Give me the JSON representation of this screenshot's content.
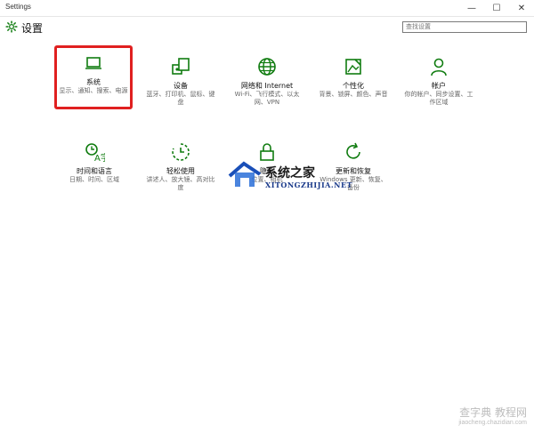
{
  "window": {
    "title": "Settings",
    "min": "—",
    "max": "☐",
    "close": "✕"
  },
  "header": {
    "title": "设置"
  },
  "search": {
    "placeholder": "查找设置"
  },
  "accent_color": "#107c10",
  "selection_color": "#e02020",
  "tiles": [
    {
      "label": "系统",
      "desc": "显示、通知、搜索、电源",
      "icon": "laptop-icon",
      "selected": true
    },
    {
      "label": "设备",
      "desc": "蓝牙、打印机、鼠标、键盘",
      "icon": "devices-icon"
    },
    {
      "label": "网络和 Internet",
      "desc": "Wi-Fi、飞行模式、以太网、VPN",
      "icon": "globe-icon"
    },
    {
      "label": "个性化",
      "desc": "背景、锁屏、颜色、声音",
      "icon": "personalization-icon"
    },
    {
      "label": "帐户",
      "desc": "你的帐户、同步设置、工作区域",
      "icon": "person-icon"
    },
    {
      "label": "时间和语言",
      "desc": "日期、时间、区域",
      "icon": "time-language-icon"
    },
    {
      "label": "轻松使用",
      "desc": "讲述人、放大镜、高对比度",
      "icon": "ease-of-access-icon"
    },
    {
      "label": "隐私",
      "desc": "位置、相机",
      "icon": "lock-icon"
    },
    {
      "label": "更新和恢复",
      "desc": "Windows 更新、恢复、备份",
      "icon": "update-icon"
    }
  ],
  "watermark": {
    "title": "系统之家",
    "site": "XITONGZHIJIA.NET"
  },
  "watermark2": {
    "title": "查字典 教程网",
    "site": "jiaocheng.chazidian.com"
  }
}
